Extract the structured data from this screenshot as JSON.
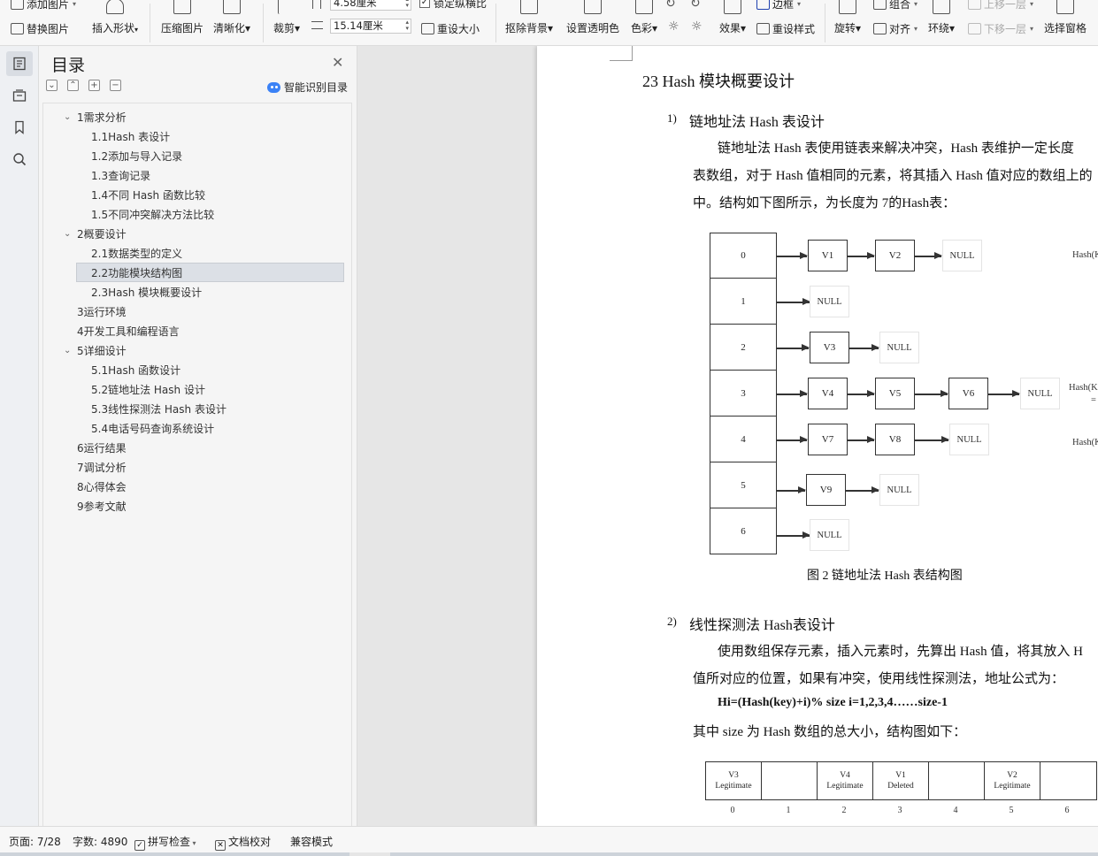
{
  "ribbon": {
    "add_image": "添加图片",
    "replace_image": "替换图片",
    "insert_shape": "插入形状",
    "compress_image": "压缩图片",
    "sharpen": "清晰化",
    "crop": "裁剪",
    "height_value": "4.58厘米",
    "width_value": "15.14厘米",
    "lock_ratio": "锁定纵横比",
    "reset_size": "重设大小",
    "remove_bg": "抠除背景",
    "set_transparent": "设置透明色",
    "color": "色彩",
    "effects": "效果",
    "border": "边框",
    "reset_style": "重设样式",
    "rotate": "旋转",
    "group": "组合",
    "align": "对齐",
    "wrap": "环绕",
    "bring_forward": "上移一层",
    "send_backward": "下移一层",
    "selection_pane": "选择窗格"
  },
  "toc": {
    "title": "目录",
    "ai_label": "智能识别目录",
    "items": [
      {
        "label": "1需求分析",
        "level": 1,
        "expanded": true
      },
      {
        "label": "1.1Hash 表设计",
        "level": 2
      },
      {
        "label": "1.2添加与导入记录",
        "level": 2
      },
      {
        "label": "1.3查询记录",
        "level": 2
      },
      {
        "label": "1.4不同 Hash 函数比较",
        "level": 2
      },
      {
        "label": "1.5不同冲突解决方法比较",
        "level": 2
      },
      {
        "label": "2概要设计",
        "level": 1,
        "expanded": true
      },
      {
        "label": "2.1数据类型的定义",
        "level": 2
      },
      {
        "label": "2.2功能模块结构图",
        "level": 2,
        "selected": true
      },
      {
        "label": "2.3Hash 模块概要设计",
        "level": 2
      },
      {
        "label": "3运行环境",
        "level": 1
      },
      {
        "label": "4开发工具和编程语言",
        "level": 1
      },
      {
        "label": "5详细设计",
        "level": 1,
        "expanded": true
      },
      {
        "label": "5.1Hash 函数设计",
        "level": 2
      },
      {
        "label": "5.2链地址法 Hash 设计",
        "level": 2
      },
      {
        "label": "5.3线性探测法 Hash 表设计",
        "level": 2
      },
      {
        "label": "5.4电话号码查询系统设计",
        "level": 2
      },
      {
        "label": "6运行结果",
        "level": 1
      },
      {
        "label": "7调试分析",
        "level": 1
      },
      {
        "label": "8心得体会",
        "level": 1
      },
      {
        "label": "9参考文献",
        "level": 1
      }
    ]
  },
  "document": {
    "heading": "23  Hash 模块概要设计",
    "sub1_num": "1)",
    "sub1_title": "链地址法 Hash 表设计",
    "para1_line1": "链地址法 Hash 表使用链表来解决冲突，Hash 表维护一定长度",
    "para1_line2": "表数组，对于 Hash 值相同的元素，将其插入 Hash 值对应的数组上的",
    "para1_line3": "中。结构如下图所示，为长度为 7的Hash表：",
    "chain_rows": [
      {
        "index": "0",
        "nodes": [
          "V1",
          "V2"
        ],
        "note": "Hash(K"
      },
      {
        "index": "1",
        "nodes": []
      },
      {
        "index": "2",
        "nodes": [
          "V3"
        ]
      },
      {
        "index": "3",
        "nodes": [
          "V4",
          "V5",
          "V6"
        ],
        "note": "Hash(K",
        "note2": "="
      },
      {
        "index": "4",
        "nodes": [
          "V7",
          "V8"
        ],
        "note": "Hash(K"
      },
      {
        "index": "5",
        "nodes": [
          "V9"
        ]
      },
      {
        "index": "6",
        "nodes": []
      }
    ],
    "null_label": "NULL",
    "caption": "图 2 链地址法 Hash 表结构图",
    "sub2_num": "2)",
    "sub2_title": "线性探测法 Hash表设计",
    "para2_line1": "使用数组保存元素，插入元素时，先算出 Hash 值，将其放入 H",
    "para2_line2": "值所对应的位置，如果有冲突，使用线性探测法，地址公式为：",
    "formula": "Hi=(Hash(key)+i)% size  i=1,2,3,4……size-1",
    "para2_line3": "其中 size 为 Hash 数组的总大小，结构图如下：",
    "linear_cells": [
      {
        "top": "V3",
        "bottom": "Legitimate"
      },
      {
        "top": "",
        "bottom": ""
      },
      {
        "top": "V4",
        "bottom": "Legitimate"
      },
      {
        "top": "V1",
        "bottom": "Deleted"
      },
      {
        "top": "",
        "bottom": ""
      },
      {
        "top": "V2",
        "bottom": "Legitimate"
      },
      {
        "top": "",
        "bottom": ""
      }
    ],
    "linear_indices": [
      "0",
      "1",
      "2",
      "3",
      "4",
      "5",
      "6"
    ]
  },
  "status": {
    "page": "页面: 7/28",
    "words": "字数: 4890",
    "spell": "拼写检查",
    "proof": "文档校对",
    "compat": "兼容模式"
  }
}
